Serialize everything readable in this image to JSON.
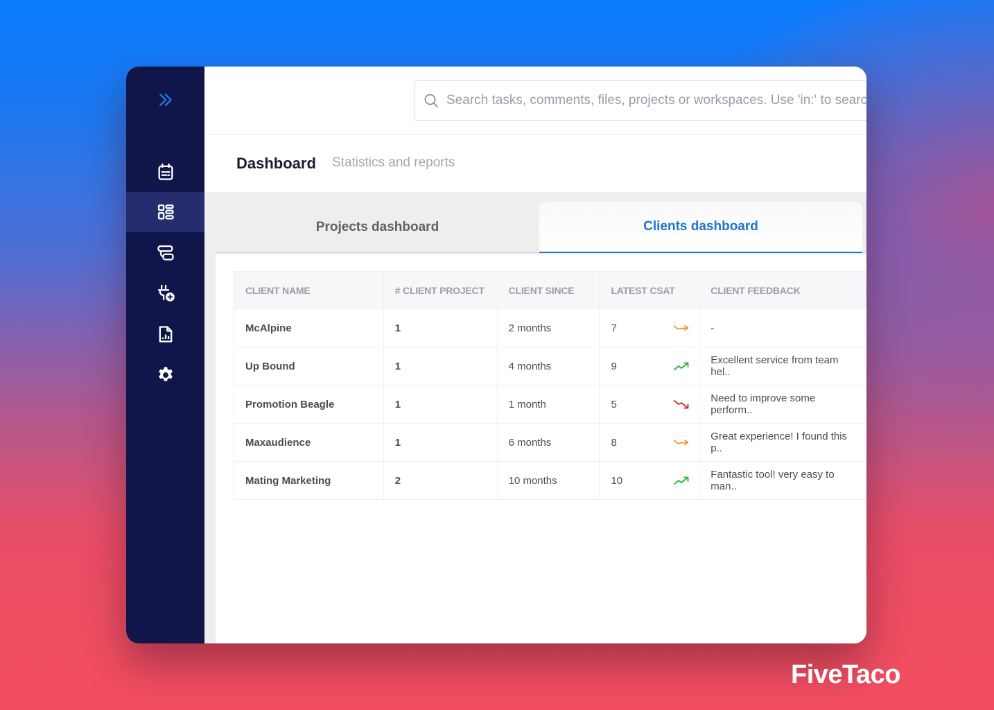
{
  "sidebar": {
    "toggle_icon": "double-chevron-right-icon",
    "items": [
      {
        "name": "calendar",
        "icon": "calendar-icon",
        "active": false
      },
      {
        "name": "dashboard",
        "icon": "dashboard-grid-icon",
        "active": true
      },
      {
        "name": "workflows",
        "icon": "workflow-icon",
        "active": false
      },
      {
        "name": "integrations",
        "icon": "plug-add-icon",
        "active": false
      },
      {
        "name": "reports",
        "icon": "report-file-icon",
        "active": false
      },
      {
        "name": "settings",
        "icon": "gear-icon",
        "active": false
      }
    ]
  },
  "search": {
    "placeholder": "Search tasks, comments, files, projects or workspaces. Use 'in:' to search",
    "value": ""
  },
  "header": {
    "title": "Dashboard",
    "subtitle": "Statistics and reports"
  },
  "tabs": [
    {
      "label": "Projects dashboard",
      "active": false
    },
    {
      "label": "Clients dashboard",
      "active": true
    }
  ],
  "table": {
    "columns": [
      "CLIENT NAME",
      "# CLIENT PROJECT",
      "CLIENT SINCE",
      "LATEST CSAT",
      "CLIENT FEEDBACK"
    ],
    "rows": [
      {
        "name": "McAlpine",
        "projects": "1",
        "since": "2 months",
        "csat": "7",
        "trend": "flat",
        "feedback": "-"
      },
      {
        "name": "Up Bound",
        "projects": "1",
        "since": "4 months",
        "csat": "9",
        "trend": "up",
        "feedback": "Excellent service from team hel.."
      },
      {
        "name": "Promotion Beagle",
        "projects": "1",
        "since": "1 month",
        "csat": "5",
        "trend": "down",
        "feedback": "Need to improve some perform.."
      },
      {
        "name": "Maxaudience",
        "projects": "1",
        "since": "6 months",
        "csat": "8",
        "trend": "flat",
        "feedback": "Great experience! I found this p.."
      },
      {
        "name": "Mating Marketing",
        "projects": "2",
        "since": "10 months",
        "csat": "10",
        "trend": "up",
        "feedback": "Fantastic tool! very easy to man.."
      }
    ]
  },
  "colors": {
    "accent": "#1e74cf",
    "sidebar_bg": "#10164a",
    "sidebar_active": "#262d6e",
    "trend_up": "#22b83a",
    "trend_down": "#d6202f",
    "trend_flat": "#f0952e"
  },
  "brand": "FiveTaco"
}
